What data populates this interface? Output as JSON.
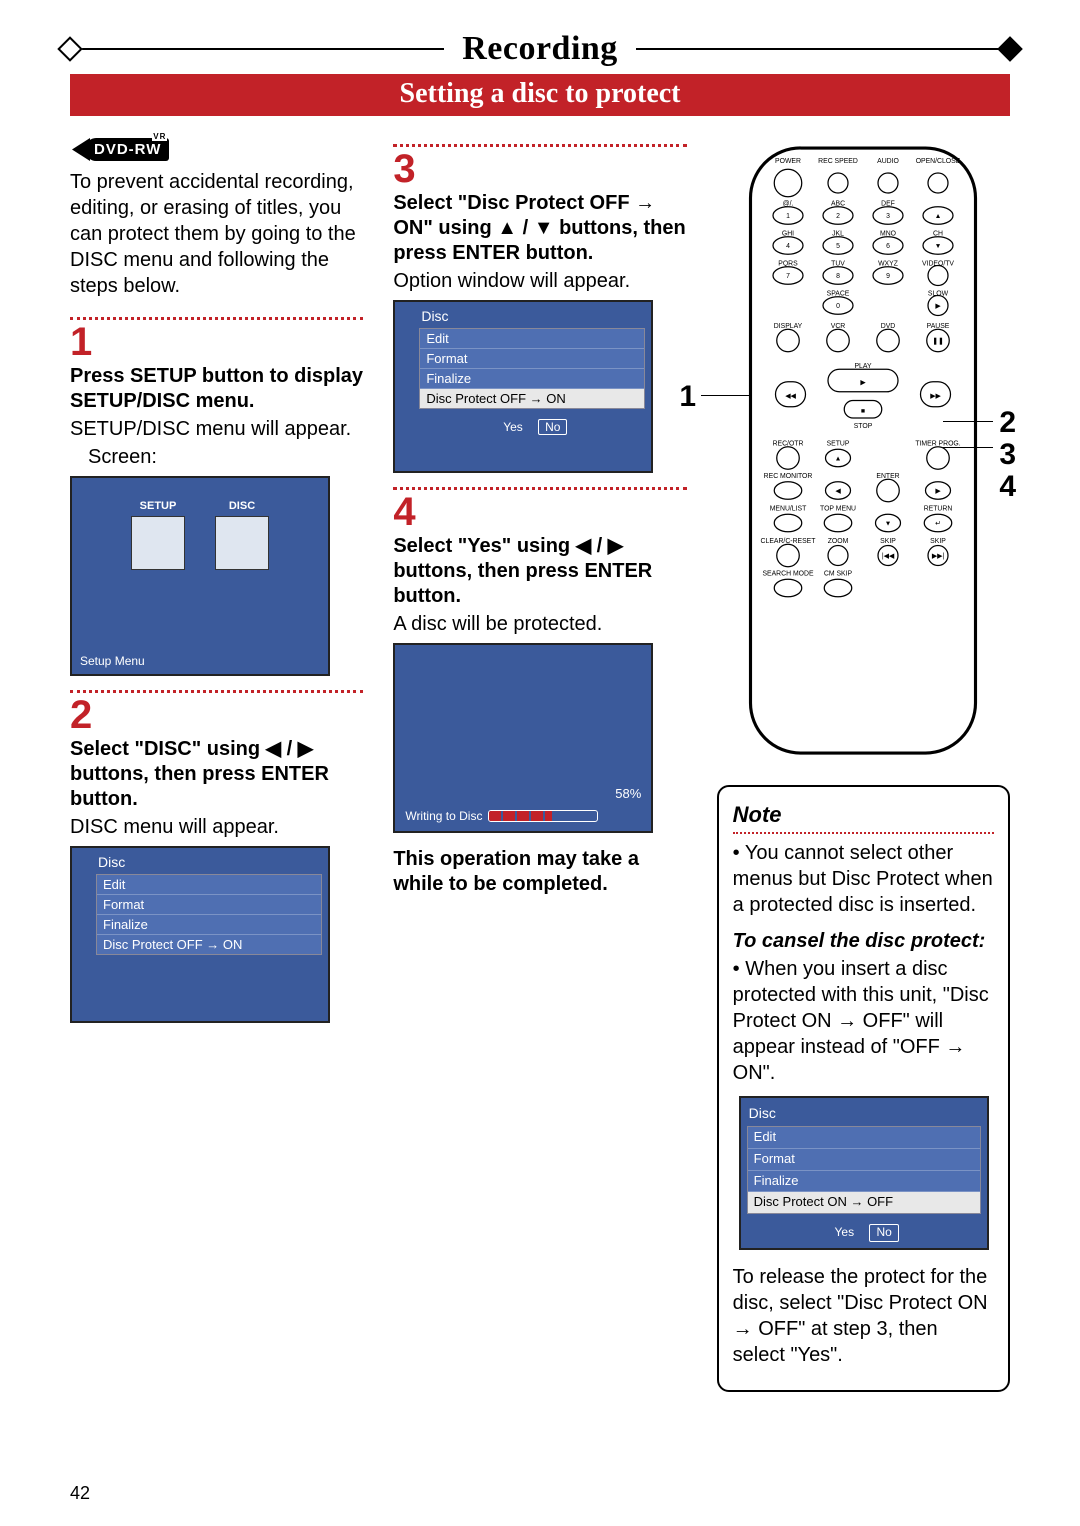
{
  "page_number": "42",
  "chapter": "Recording",
  "section": "Setting a disc to protect",
  "badge": {
    "text": "DVD-RW",
    "vr": "VR"
  },
  "intro": "To prevent accidental recording, editing, or erasing of titles, you can protect them by going to the DISC menu and following the steps below.",
  "steps": {
    "s1": {
      "num": "1",
      "title": "Press SETUP button to display SETUP/DISC menu.",
      "body": "SETUP/DISC menu will appear.",
      "screen_label": "Screen:",
      "setup_icons": [
        "SETUP",
        "DISC"
      ],
      "setup_footer": "Setup Menu"
    },
    "s2": {
      "num": "2",
      "title": "Select \"DISC\" using ◀ / ▶ buttons, then press ENTER button.",
      "body": "DISC menu will appear.",
      "osd": {
        "title": "Disc",
        "rows": [
          "Edit",
          "Format",
          "Finalize",
          "Disc Protect OFF → ON"
        ]
      }
    },
    "s3": {
      "num": "3",
      "title": "Select \"Disc Protect OFF → ON\" using ▲ / ▼ buttons, then press ENTER button.",
      "body": "Option window will appear.",
      "osd": {
        "title": "Disc",
        "rows": [
          "Edit",
          "Format",
          "Finalize",
          "Disc Protect OFF → ON"
        ],
        "yes": "Yes",
        "no": "No"
      }
    },
    "s4": {
      "num": "4",
      "title": "Select \"Yes\" using ◀ / ▶ buttons, then press ENTER button.",
      "body": "A disc will be protected.",
      "progress": {
        "pct": "58%",
        "writing": "Writing to Disc"
      },
      "footnote": "This operation may take a while to be completed."
    }
  },
  "remote_callouts": {
    "left1": "1",
    "right2": "2",
    "right3": "3",
    "right4": "4"
  },
  "note": {
    "title": "Note",
    "p1": "• You cannot select other menus but Disc Protect when a protected disc is inserted.",
    "subtitle": "To cansel the disc protect:",
    "p2": "• When you insert a disc protected with this unit, \"Disc Protect ON → OFF\" will appear instead of \"OFF → ON\".",
    "osd": {
      "title": "Disc",
      "rows": [
        "Edit",
        "Format",
        "Finalize",
        "Disc Protect ON  → OFF"
      ],
      "yes": "Yes",
      "no": "No"
    },
    "p3": "To release the protect for the disc, select \"Disc Protect ON → OFF\" at step 3, then select \"Yes\"."
  },
  "remote_labels": {
    "row0": [
      "POWER",
      "REC SPEED",
      "AUDIO",
      "OPEN/CLOSE"
    ],
    "row1": [
      "@/.",
      "ABC",
      "DEF",
      ""
    ],
    "row1n": [
      "1",
      "2",
      "3",
      ""
    ],
    "row2": [
      "GHI",
      "JKL",
      "MNO",
      "CH"
    ],
    "row2n": [
      "4",
      "5",
      "6",
      ""
    ],
    "row3": [
      "PQRS",
      "TUV",
      "WXYZ",
      "VIDEO/TV"
    ],
    "row3n": [
      "7",
      "8",
      "9",
      ""
    ],
    "row4": [
      "",
      "SPACE",
      "",
      "SLOW"
    ],
    "row4n": [
      "",
      "0",
      "",
      ""
    ],
    "row5": [
      "DISPLAY",
      "VCR",
      "DVD",
      "PAUSE"
    ],
    "play": "PLAY",
    "stop": "STOP",
    "row6": [
      "REC/OTR",
      "SETUP",
      "",
      "TIMER PROG."
    ],
    "row7": [
      "REC MONITOR",
      "",
      "ENTER",
      ""
    ],
    "row8": [
      "MENU/LIST",
      "TOP MENU",
      "",
      "RETURN"
    ],
    "row9": [
      "CLEAR/C-RESET",
      "ZOOM",
      "SKIP",
      "SKIP"
    ],
    "row10": [
      "SEARCH MODE",
      "CM SKIP",
      "",
      ""
    ]
  }
}
